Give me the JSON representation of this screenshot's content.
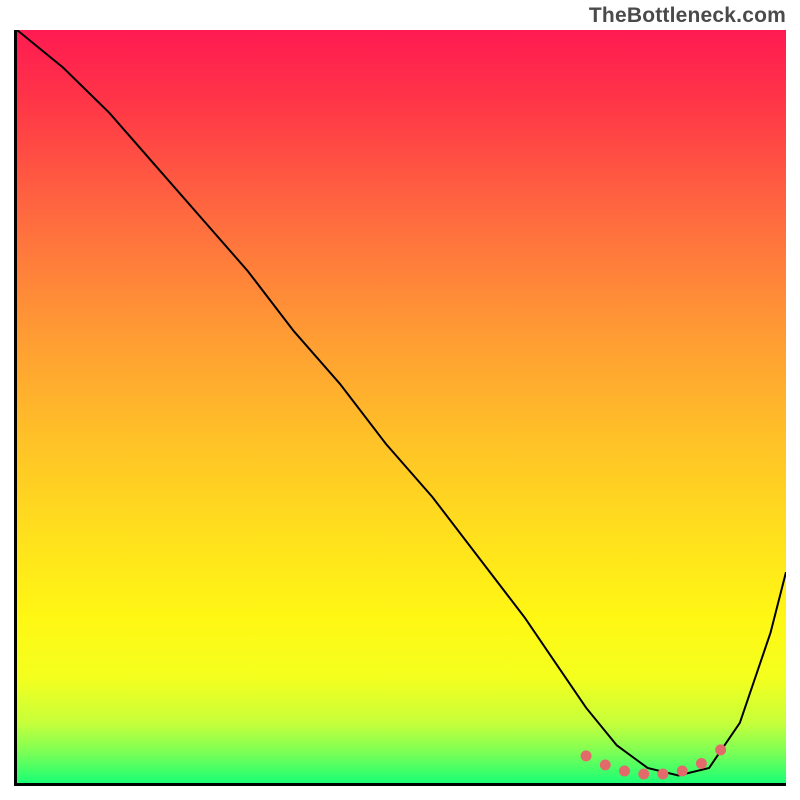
{
  "watermark": "TheBottleneck.com",
  "chart_data": {
    "type": "line",
    "title": "",
    "xlabel": "",
    "ylabel": "",
    "xlim": [
      0,
      100
    ],
    "ylim": [
      0,
      100
    ],
    "grid": false,
    "series": [
      {
        "name": "curve",
        "color": "#000000",
        "stroke_width": 2,
        "x": [
          0,
          6,
          12,
          18,
          24,
          30,
          36,
          42,
          48,
          54,
          60,
          66,
          70,
          74,
          78,
          82,
          86,
          90,
          94,
          98,
          100
        ],
        "y": [
          100,
          95,
          89,
          82,
          75,
          68,
          60,
          53,
          45,
          38,
          30,
          22,
          16,
          10,
          5,
          2,
          1,
          2,
          8,
          20,
          28
        ]
      },
      {
        "name": "flat-zone-markers",
        "type": "scatter",
        "color": "#e36a6a",
        "marker_size": 11,
        "x": [
          74,
          76.5,
          79,
          81.5,
          84,
          86.5,
          89,
          91.5
        ],
        "y": [
          3.6,
          2.4,
          1.6,
          1.2,
          1.2,
          1.6,
          2.6,
          4.4
        ]
      }
    ],
    "background_gradient": {
      "type": "linear-vertical",
      "stops": [
        {
          "offset": 0.0,
          "color": "#ff1a52"
        },
        {
          "offset": 0.1,
          "color": "#ff3747"
        },
        {
          "offset": 0.25,
          "color": "#ff6b3f"
        },
        {
          "offset": 0.4,
          "color": "#ff9a34"
        },
        {
          "offset": 0.55,
          "color": "#ffc327"
        },
        {
          "offset": 0.68,
          "color": "#ffe21c"
        },
        {
          "offset": 0.78,
          "color": "#fff714"
        },
        {
          "offset": 0.86,
          "color": "#f4ff1e"
        },
        {
          "offset": 0.92,
          "color": "#c7ff3a"
        },
        {
          "offset": 0.96,
          "color": "#7aff56"
        },
        {
          "offset": 1.0,
          "color": "#1aff74"
        }
      ]
    }
  }
}
